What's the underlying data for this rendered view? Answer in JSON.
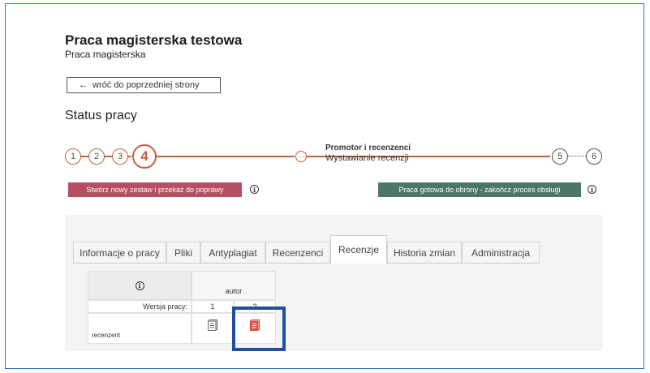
{
  "header": {
    "title": "Praca magisterska testowa",
    "subtitle": "Praca magisterska"
  },
  "back_button": {
    "arrow": "←",
    "label": "wróć do poprzedniej strony"
  },
  "status": {
    "title": "Status pracy",
    "steps_done": [
      "1",
      "2",
      "3"
    ],
    "current_step": "4",
    "current_step_title": "Promotor i recenzenci",
    "current_step_subtitle": "Wystawianie recenzji",
    "future_steps": [
      "5",
      "6"
    ]
  },
  "actions": {
    "new_set_label": "Stwórz nowy zestaw i przekaż do poprawy",
    "ready_label": "Praca gotowa do obrony - zakończ proces obsługi"
  },
  "tabs": [
    {
      "label": "Informacje o pracy",
      "active": false
    },
    {
      "label": "Pliki",
      "active": false
    },
    {
      "label": "Antyplagiat",
      "active": false
    },
    {
      "label": "Recenzenci",
      "active": false
    },
    {
      "label": "Recenzje",
      "active": true
    },
    {
      "label": "Historia zmian",
      "active": false
    },
    {
      "label": "Administracja",
      "active": false
    }
  ],
  "reviews_table": {
    "author_header": "autor",
    "version_label": "Wersja pracy:",
    "version_values": [
      "1",
      "2"
    ],
    "reviewer_label": "recenzent"
  },
  "colors": {
    "accent": "#c0623a",
    "red_button": "#b64f63",
    "green_button": "#4c7767",
    "highlight": "#1f4f9e"
  }
}
